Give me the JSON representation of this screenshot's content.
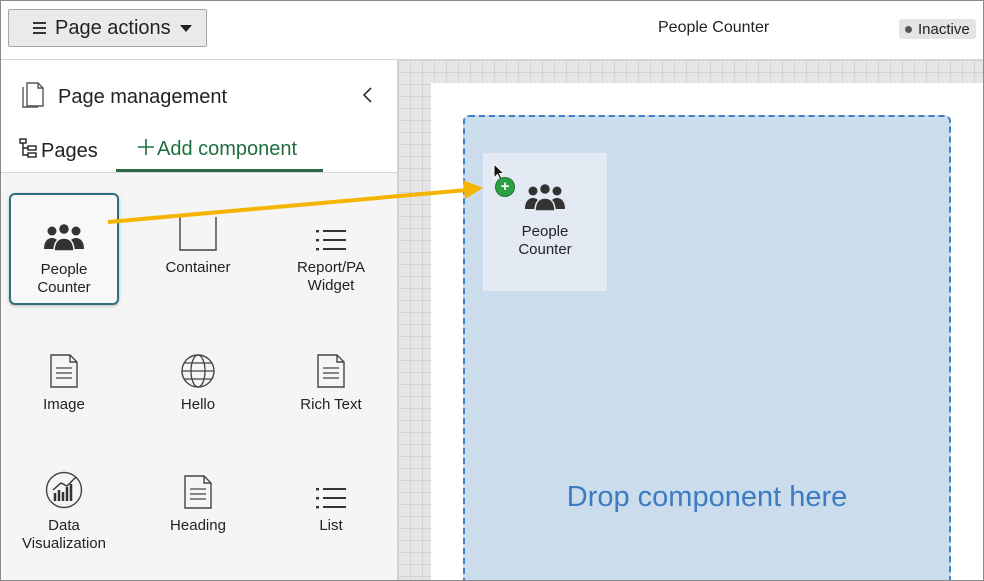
{
  "topbar": {
    "page_actions_label": "Page actions",
    "app_title": "People Counter",
    "status_label": "Inactive"
  },
  "panel": {
    "title": "Page management",
    "tabs": [
      {
        "label": "Pages"
      },
      {
        "label": "Add component"
      }
    ],
    "components": [
      {
        "label_line1": "People",
        "label_line2": "Counter",
        "icon": "people-icon"
      },
      {
        "label_line1": "Container",
        "label_line2": "",
        "icon": "container-icon"
      },
      {
        "label_line1": "Report/PA",
        "label_line2": "Widget",
        "icon": "list-icon"
      },
      {
        "label_line1": "Image",
        "label_line2": "",
        "icon": "document-icon"
      },
      {
        "label_line1": "Hello",
        "label_line2": "",
        "icon": "globe-icon"
      },
      {
        "label_line1": "Rich Text",
        "label_line2": "",
        "icon": "document-icon"
      },
      {
        "label_line1": "Data",
        "label_line2": "Visualization",
        "icon": "chart-icon"
      },
      {
        "label_line1": "Heading",
        "label_line2": "",
        "icon": "document-icon"
      },
      {
        "label_line1": "List",
        "label_line2": "",
        "icon": "list-icon"
      }
    ]
  },
  "canvas": {
    "drop_text": "Drop component here",
    "ghost_line1": "People",
    "ghost_line2": "Counter"
  },
  "colors": {
    "accent_green": "#1d6f3f",
    "drop_blue": "#3d7cc3",
    "arrow_yellow": "#f5b400"
  }
}
